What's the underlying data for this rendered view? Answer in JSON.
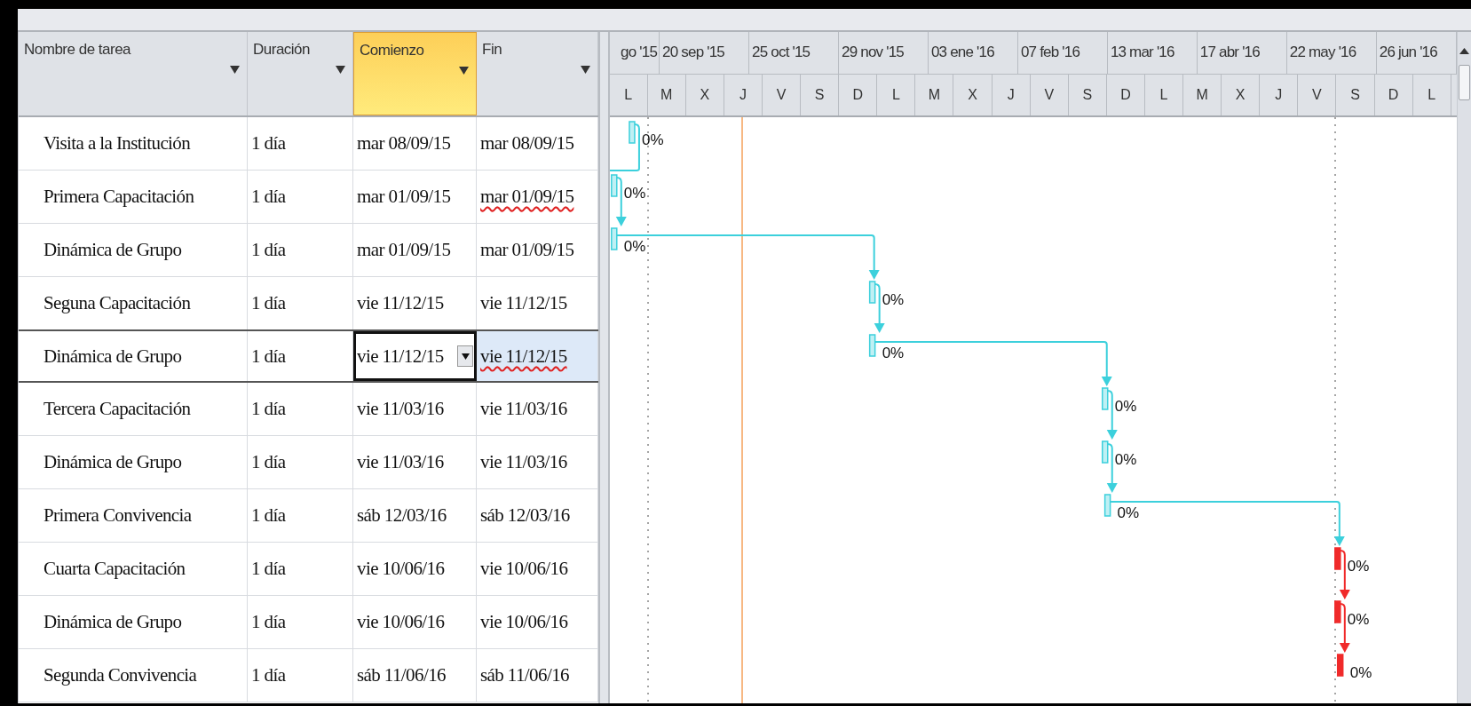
{
  "columns": [
    {
      "label": "Nombre de tarea",
      "selected": false
    },
    {
      "label": "Duración",
      "selected": false
    },
    {
      "label": "Comienzo",
      "selected": true
    },
    {
      "label": "Fin",
      "selected": false
    }
  ],
  "timescale": {
    "top": [
      "go '15",
      "20 sep '15",
      "25 oct '15",
      "29 nov '15",
      "03 ene '16",
      "07 feb '16",
      "13 mar '16",
      "17 abr '16",
      "22 may '16",
      "26 jun '16"
    ],
    "bottom": [
      "L",
      "M",
      "X",
      "J",
      "V",
      "S",
      "D",
      "L",
      "M",
      "X",
      "J",
      "V",
      "S",
      "D",
      "L",
      "M",
      "X",
      "J",
      "V",
      "S",
      "D",
      "L"
    ]
  },
  "tasks": [
    {
      "name": "Visita a la Institución",
      "duration": "1 día",
      "start": "mar 08/09/15",
      "end": "mar 08/09/15",
      "progress": "0%",
      "critical": false,
      "selected": false,
      "end_flagged": false
    },
    {
      "name": "Primera Capacitación",
      "duration": "1 día",
      "start": "mar 01/09/15",
      "end": "mar 01/09/15",
      "progress": "0%",
      "critical": false,
      "selected": false,
      "end_flagged": true
    },
    {
      "name": "Dinámica de Grupo",
      "duration": "1 día",
      "start": "mar 01/09/15",
      "end": "mar 01/09/15",
      "progress": "0%",
      "critical": false,
      "selected": false,
      "end_flagged": false
    },
    {
      "name": "Seguna Capacitación",
      "duration": "1 día",
      "start": "vie 11/12/15",
      "end": "vie 11/12/15",
      "progress": "0%",
      "critical": false,
      "selected": false,
      "end_flagged": false
    },
    {
      "name": "Dinámica de Grupo",
      "duration": "1 día",
      "start": "vie 11/12/15",
      "end": "vie 11/12/15",
      "progress": "0%",
      "critical": false,
      "selected": true,
      "end_flagged": true
    },
    {
      "name": "Tercera Capacitación",
      "duration": "1 día",
      "start": "vie 11/03/16",
      "end": "vie 11/03/16",
      "progress": "0%",
      "critical": false,
      "selected": false,
      "end_flagged": false
    },
    {
      "name": "Dinámica de Grupo",
      "duration": "1 día",
      "start": "vie 11/03/16",
      "end": "vie 11/03/16",
      "progress": "0%",
      "critical": false,
      "selected": false,
      "end_flagged": false
    },
    {
      "name": "Primera Convivencia",
      "duration": "1 día",
      "start": "sáb 12/03/16",
      "end": "sáb 12/03/16",
      "progress": "0%",
      "critical": false,
      "selected": false,
      "end_flagged": false
    },
    {
      "name": "Cuarta Capacitación",
      "duration": "1 día",
      "start": "vie 10/06/16",
      "end": "vie 10/06/16",
      "progress": "0%",
      "critical": true,
      "selected": false,
      "end_flagged": false
    },
    {
      "name": "Dinámica de Grupo",
      "duration": "1 día",
      "start": "vie 10/06/16",
      "end": "vie 10/06/16",
      "progress": "0%",
      "critical": true,
      "selected": false,
      "end_flagged": false
    },
    {
      "name": "Segunda Convivencia",
      "duration": "1 día",
      "start": "sáb 11/06/16",
      "end": "sáb 11/06/16",
      "progress": "0%",
      "critical": true,
      "selected": false,
      "end_flagged": false
    }
  ]
}
